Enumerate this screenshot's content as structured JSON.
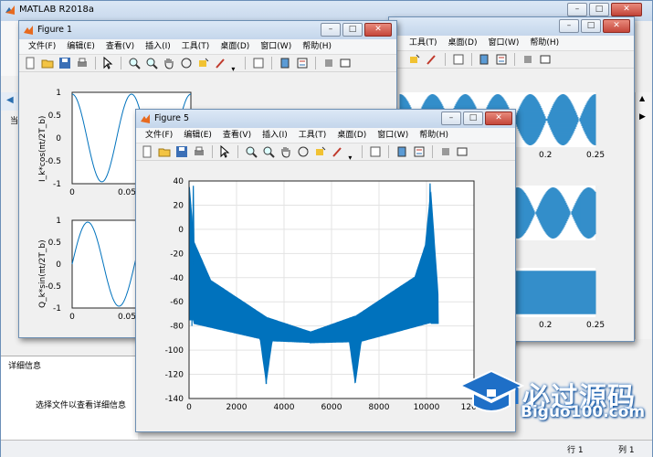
{
  "matlab": {
    "title": "MATLAB R2018a",
    "detail_panel_title": "详细信息",
    "detail_panel_text": "选择文件以查看详细信息",
    "status_row_label": "行",
    "status_row_value": "1",
    "status_col_label": "列",
    "status_col_value": "1",
    "sidebar_char": "当"
  },
  "menus": [
    "文件(F)",
    "编辑(E)",
    "查看(V)",
    "插入(I)",
    "工具(T)",
    "桌面(D)",
    "窗口(W)",
    "帮助(H)"
  ],
  "back_fig_menus": [
    "工具(T)",
    "桌面(D)",
    "窗口(W)",
    "帮助(H)"
  ],
  "figure1": {
    "title": "Figure 1",
    "top_ylabel": "I_k*cos(πt/2T_b)",
    "bottom_ylabel": "Q_k*sin(πt/2T_b)",
    "y_ticks": [
      "1",
      "0.5",
      "0",
      "-0.5",
      "-1"
    ],
    "x_ticks": [
      "0",
      "0.05"
    ]
  },
  "back_figure": {
    "x_ticks": [
      "0.2",
      "0.25"
    ]
  },
  "figure5": {
    "title": "Figure 5",
    "y_ticks": [
      "40",
      "20",
      "0",
      "-20",
      "-40",
      "-60",
      "-80",
      "-100",
      "-120",
      "-140"
    ],
    "x_ticks": [
      "0",
      "2000",
      "4000",
      "6000",
      "8000",
      "10000",
      "12000"
    ]
  },
  "chart_data": {
    "type": "line",
    "xlim": [
      0,
      12000
    ],
    "ylim": [
      -140,
      40
    ],
    "grid": true,
    "series_color": "#0072bd"
  },
  "watermark": {
    "brand": "必过源码",
    "url": "Biguo100.com"
  },
  "colors": {
    "plot_line": "#0072bd",
    "titlebar": "#c7d8ec"
  }
}
